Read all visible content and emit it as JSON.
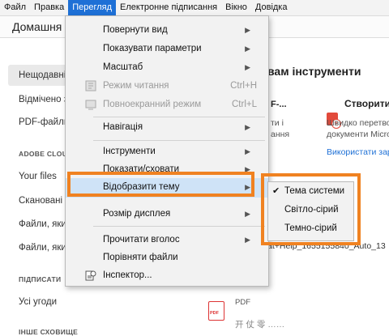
{
  "menubar": {
    "items": [
      "Файл",
      "Правка",
      "Перегляд",
      "Електронне підписання",
      "Вікно",
      "Довідка"
    ]
  },
  "home_tab": {
    "label": "Домашня с"
  },
  "sidebar": {
    "items": [
      {
        "label": "Нещодавні"
      },
      {
        "label": "Відмічено з"
      },
      {
        "label": "PDF-файли"
      },
      {
        "label": "Your files"
      },
      {
        "label": "Скановані"
      },
      {
        "label": "Файли, яки"
      },
      {
        "label": "Файли, яки"
      },
      {
        "label": "Усі угоди"
      }
    ],
    "sections": {
      "cloud": "ADOBE CLOUD",
      "sign": "ПІДПИСАТИ",
      "other": "ІНШЕ СХОВИЩЕ"
    }
  },
  "main": {
    "heading": "вам інструменти",
    "fragments": {
      "f1": "F-...",
      "f2": "ти і",
      "f3": "ання",
      "create_label": "Створити",
      "create_desc1": "Швидко перетвор",
      "create_desc2": "документи Micros",
      "use_link": "Використати зара",
      "filename": "at+Help_1655155840_Auto_13",
      "pdf_type": "PDF",
      "pdf_badge": "PDF",
      "bottom": "开 仗 零 ……"
    }
  },
  "view_menu": {
    "items": [
      {
        "label": "Повернути вид",
        "submenu": true
      },
      {
        "label": "Показувати параметри",
        "submenu": true
      },
      {
        "label": "Масштаб",
        "submenu": true
      },
      {
        "label": "Режим читання",
        "shortcut": "Ctrl+H",
        "disabled": true
      },
      {
        "label": "Повноекранний режим",
        "shortcut": "Ctrl+L",
        "disabled": true
      },
      {
        "label": "Навігація",
        "submenu": true
      },
      {
        "label": "Інструменти",
        "submenu": true
      },
      {
        "label": "Показати/сховати",
        "submenu": true
      },
      {
        "label": "Відобразити тему",
        "submenu": true,
        "highlighted": true
      },
      {
        "label": "Розмір дисплея",
        "submenu": true
      },
      {
        "label": "Прочитати вголос",
        "submenu": true
      },
      {
        "label": "Порівняти файли"
      },
      {
        "label": "Інспектор..."
      }
    ]
  },
  "theme_submenu": {
    "items": [
      {
        "label": "Тема системи",
        "checked": true
      },
      {
        "label": "Світло-сірий"
      },
      {
        "label": "Темно-сірий"
      }
    ]
  },
  "colors": {
    "accent": "#1e70d6",
    "highlight_box": "#f08221",
    "create_icon": "#e24a3b"
  }
}
